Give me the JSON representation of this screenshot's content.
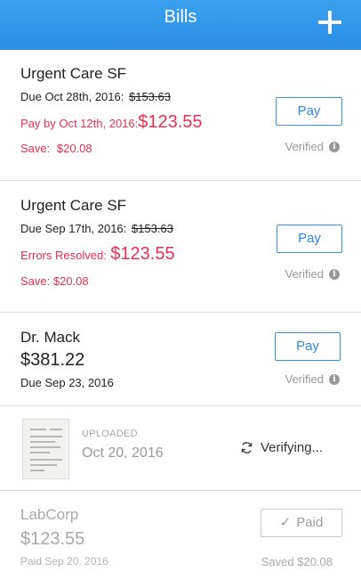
{
  "header": {
    "title": "Bills",
    "add_icon": "plus-icon"
  },
  "bills": [
    {
      "provider": "Urgent Care SF",
      "due_label": "Due Oct 28th, 2016:",
      "original_amount": "$153.63",
      "offer_label": "Pay by Oct 12th, 2016:",
      "offer_amount": "$123.55",
      "save_label": "Save:",
      "save_amount": "$20.08",
      "action_label": "Pay",
      "status": "Verified",
      "status_icon": "info-icon"
    },
    {
      "provider": "Urgent Care SF",
      "due_label": "Due Sep 17th, 2016:",
      "original_amount": "$153.63",
      "offer_label": "Errors Resolved:",
      "offer_amount": "$123.55",
      "save_text": "Save: $20.08",
      "action_label": "Pay",
      "status": "Verified",
      "status_icon": "info-icon"
    },
    {
      "provider": "Dr. Mack",
      "amount": "$381.22",
      "due_text": "Due Sep 23, 2016",
      "action_label": "Pay",
      "status": "Verified",
      "status_icon": "info-icon"
    },
    {
      "thumbnail": "document-thumbnail",
      "uploaded_label": "UPLOADED",
      "uploaded_date": "Oct 20, 2016",
      "status": "Verifying...",
      "status_icon": "refresh-icon"
    },
    {
      "provider": "LabCorp",
      "amount": "$123.55",
      "paid_text": "Paid Sep 20, 2016",
      "action_label": "Paid",
      "action_icon": "check-icon",
      "saved_text": "Saved $20.08"
    }
  ],
  "colors": {
    "header": "#2a8fe6",
    "accent": "#3a8fe0",
    "discount": "#ee2d53",
    "muted": "#a9a9a9"
  }
}
